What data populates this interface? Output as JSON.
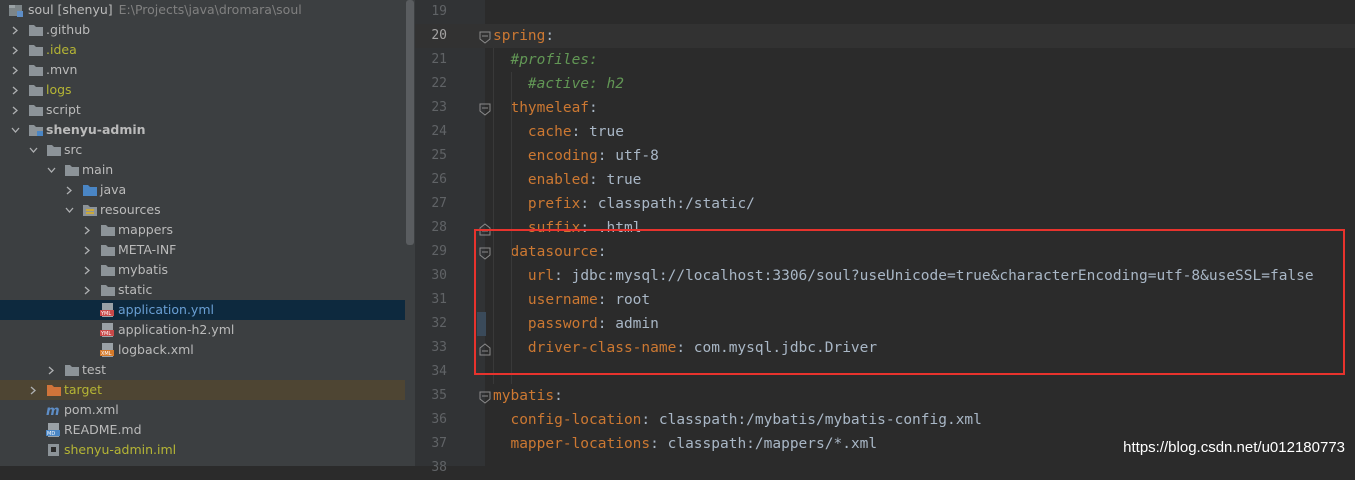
{
  "project_tree": {
    "root": {
      "name": "soul [shenyu]",
      "path": "E:\\Projects\\java\\dromara\\soul"
    },
    "items": [
      {
        "label": ".github",
        "type": "folder",
        "color": "#bbbbbb"
      },
      {
        "label": ".idea",
        "type": "folder",
        "color": "#b5b535"
      },
      {
        "label": ".mvn",
        "type": "folder",
        "color": "#bbbbbb"
      },
      {
        "label": "logs",
        "type": "folder",
        "color": "#b5b535"
      },
      {
        "label": "script",
        "type": "folder",
        "color": "#bbbbbb"
      },
      {
        "label": "shenyu-admin",
        "type": "module",
        "color": "#bbbbbb"
      },
      {
        "label": "src",
        "type": "folder",
        "color": "#bbbbbb"
      },
      {
        "label": "main",
        "type": "folder",
        "color": "#bbbbbb"
      },
      {
        "label": "java",
        "type": "source-folder",
        "color": "#bbbbbb"
      },
      {
        "label": "resources",
        "type": "resources-folder",
        "color": "#bbbbbb"
      },
      {
        "label": "mappers",
        "type": "folder",
        "color": "#bbbbbb"
      },
      {
        "label": "META-INF",
        "type": "folder",
        "color": "#bbbbbb"
      },
      {
        "label": "mybatis",
        "type": "folder",
        "color": "#bbbbbb"
      },
      {
        "label": "static",
        "type": "folder",
        "color": "#bbbbbb"
      },
      {
        "label": "application.yml",
        "type": "yml-file",
        "color": "#6a9fd4"
      },
      {
        "label": "application-h2.yml",
        "type": "yml-file",
        "color": "#bbbbbb"
      },
      {
        "label": "logback.xml",
        "type": "xml-file",
        "color": "#bbbbbb"
      },
      {
        "label": "test",
        "type": "folder",
        "color": "#bbbbbb"
      },
      {
        "label": "target",
        "type": "excluded-folder",
        "color": "#b5b535"
      },
      {
        "label": "pom.xml",
        "type": "maven-file",
        "color": "#bbbbbb"
      },
      {
        "label": "README.md",
        "type": "md-file",
        "color": "#bbbbbb"
      },
      {
        "label": "shenyu-admin.iml",
        "type": "iml-file",
        "color": "#b5b535"
      }
    ]
  },
  "editor": {
    "current_line": "20",
    "lines": [
      {
        "n": "19",
        "parts": []
      },
      {
        "n": "20",
        "parts": [
          {
            "k": "spring"
          },
          {
            "t": ":"
          }
        ]
      },
      {
        "n": "21",
        "parts": [
          {
            "t": "  "
          },
          {
            "c": "#profiles:"
          }
        ]
      },
      {
        "n": "22",
        "parts": [
          {
            "t": "    "
          },
          {
            "c": "#active: h2"
          }
        ]
      },
      {
        "n": "23",
        "parts": [
          {
            "t": "  "
          },
          {
            "k": "thymeleaf"
          },
          {
            "t": ":"
          }
        ]
      },
      {
        "n": "24",
        "parts": [
          {
            "t": "    "
          },
          {
            "k": "cache"
          },
          {
            "t": ": true"
          }
        ]
      },
      {
        "n": "25",
        "parts": [
          {
            "t": "    "
          },
          {
            "k": "encoding"
          },
          {
            "t": ": utf-8"
          }
        ]
      },
      {
        "n": "26",
        "parts": [
          {
            "t": "    "
          },
          {
            "k": "enabled"
          },
          {
            "t": ": true"
          }
        ]
      },
      {
        "n": "27",
        "parts": [
          {
            "t": "    "
          },
          {
            "k": "prefix"
          },
          {
            "t": ": classpath:/static/"
          }
        ]
      },
      {
        "n": "28",
        "parts": [
          {
            "t": "    "
          },
          {
            "k": "suffix"
          },
          {
            "t": ": .html"
          }
        ]
      },
      {
        "n": "29",
        "parts": [
          {
            "t": "  "
          },
          {
            "k": "datasource"
          },
          {
            "t": ":"
          }
        ]
      },
      {
        "n": "30",
        "parts": [
          {
            "t": "    "
          },
          {
            "k": "url"
          },
          {
            "t": ": jdbc:mysql://localhost:3306/soul?useUnicode=true&characterEncoding=utf-8&useSSL=false"
          }
        ]
      },
      {
        "n": "31",
        "parts": [
          {
            "t": "    "
          },
          {
            "k": "username"
          },
          {
            "t": ": root"
          }
        ]
      },
      {
        "n": "32",
        "parts": [
          {
            "t": "    "
          },
          {
            "k": "password"
          },
          {
            "t": ": admin"
          }
        ]
      },
      {
        "n": "33",
        "parts": [
          {
            "t": "    "
          },
          {
            "k": "driver-class-name"
          },
          {
            "t": ": com.mysql.jdbc.Driver"
          }
        ]
      },
      {
        "n": "34",
        "parts": []
      },
      {
        "n": "35",
        "parts": [
          {
            "k": "mybatis"
          },
          {
            "t": ":"
          }
        ]
      },
      {
        "n": "36",
        "parts": [
          {
            "t": "  "
          },
          {
            "k": "config-location"
          },
          {
            "t": ": classpath:/mybatis/mybatis-config.xml"
          }
        ]
      },
      {
        "n": "37",
        "parts": [
          {
            "t": "  "
          },
          {
            "k": "mapper-locations"
          },
          {
            "t": ": classpath:/mappers/*.xml"
          }
        ]
      },
      {
        "n": "38",
        "parts": []
      }
    ]
  },
  "watermark": "https://blog.csdn.net/u012180773",
  "colors": {
    "key": "#cc7832",
    "comment": "#629755",
    "text": "#a9b7c6",
    "highlight_box": "#e8332d",
    "selected_row": "#0d293e"
  }
}
